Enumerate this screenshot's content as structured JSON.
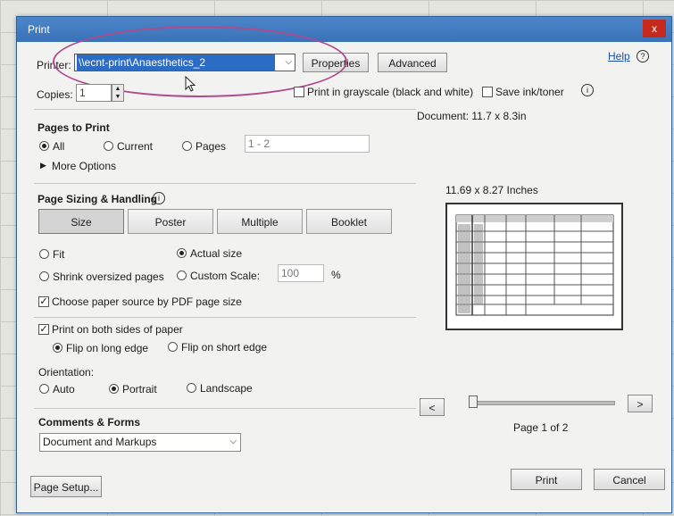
{
  "window": {
    "title": "Print",
    "close_glyph": "x"
  },
  "printer": {
    "label": "Printer:",
    "value": "\\\\ecnt-print\\Anaesthetics_2",
    "properties_label": "Properties",
    "advanced_label": "Advanced"
  },
  "help": {
    "label": "Help"
  },
  "copies": {
    "label": "Copies:",
    "value": "1"
  },
  "options": {
    "grayscale_label": "Print in grayscale (black and white)",
    "save_ink_label": "Save ink/toner"
  },
  "pages_to_print": {
    "heading": "Pages to Print",
    "all_label": "All",
    "current_label": "Current",
    "pages_label": "Pages",
    "pages_value": "1 - 2",
    "more_options_label": "More Options",
    "selected": "All"
  },
  "page_sizing": {
    "heading": "Page Sizing & Handling",
    "tabs": [
      "Size",
      "Poster",
      "Multiple",
      "Booklet"
    ],
    "selected_tab": "Size",
    "fit_label": "Fit",
    "actual_size_label": "Actual size",
    "shrink_label": "Shrink oversized pages",
    "custom_scale_label": "Custom Scale:",
    "custom_scale_value": "100",
    "percent_label": "%",
    "paper_source_label": "Choose paper source by PDF page size",
    "paper_source_checked": true,
    "selected_size": "Actual size"
  },
  "duplex": {
    "both_sides_label": "Print on both sides of paper",
    "both_sides_checked": true,
    "long_edge_label": "Flip on long edge",
    "short_edge_label": "Flip on short edge",
    "selected": "Flip on long edge"
  },
  "orientation": {
    "heading": "Orientation:",
    "auto_label": "Auto",
    "portrait_label": "Portrait",
    "landscape_label": "Landscape",
    "selected": "Portrait"
  },
  "comments": {
    "heading": "Comments & Forms",
    "value": "Document and Markups"
  },
  "preview": {
    "document_label": "Document: 11.7 x 8.3in",
    "size_label": "11.69 x 8.27 Inches",
    "page_label": "Page 1 of 2",
    "prev_glyph": "<",
    "next_glyph": ">",
    "page_position": 0
  },
  "footer": {
    "page_setup_label": "Page Setup...",
    "print_label": "Print",
    "cancel_label": "Cancel"
  },
  "colors": {
    "title_bar": "#3a72b8",
    "close_red": "#c42b1c",
    "annotation_circle": "#b04a8c"
  }
}
